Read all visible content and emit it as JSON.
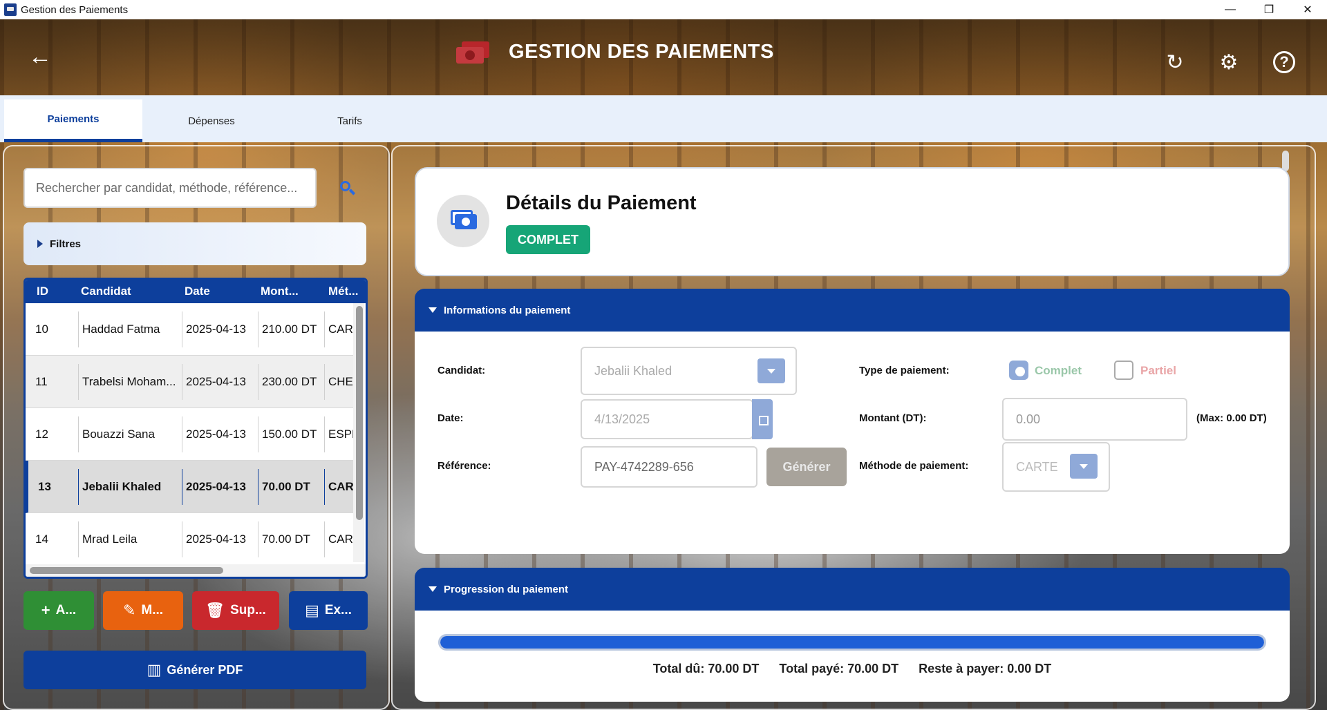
{
  "window": {
    "title": "Gestion des Paiements",
    "minimize": "—",
    "maximize": "❐",
    "close": "✕"
  },
  "header": {
    "title": "GESTION DES PAIEMENTS",
    "back": "←",
    "refresh": "↻",
    "settings": "⚙",
    "help": "?"
  },
  "tabs": [
    {
      "label": "Paiements",
      "active": true
    },
    {
      "label": "Dépenses",
      "active": false
    },
    {
      "label": "Tarifs",
      "active": false
    }
  ],
  "search": {
    "placeholder": "Rechercher par candidat, méthode, référence..."
  },
  "filters": {
    "label": "Filtres"
  },
  "table": {
    "columns": [
      "ID",
      "Candidat",
      "Date",
      "Mont...",
      "Mét..."
    ],
    "rows": [
      {
        "id": "10",
        "candidat": "Haddad Fatma",
        "date": "2025-04-13",
        "montant": "210.00 DT",
        "methode": "CARTE"
      },
      {
        "id": "11",
        "candidat": "Trabelsi Moham...",
        "date": "2025-04-13",
        "montant": "230.00 DT",
        "methode": "CHEQUE"
      },
      {
        "id": "12",
        "candidat": "Bouazzi Sana",
        "date": "2025-04-13",
        "montant": "150.00 DT",
        "methode": "ESPECES"
      },
      {
        "id": "13",
        "candidat": "Jebalii Khaled",
        "date": "2025-04-13",
        "montant": "70.00 DT",
        "methode": "CARTE"
      },
      {
        "id": "14",
        "candidat": "Mrad Leila",
        "date": "2025-04-13",
        "montant": "70.00 DT",
        "methode": "CARTE"
      }
    ]
  },
  "actions": {
    "add": "A...",
    "edit": "M...",
    "delete": "Sup...",
    "export": "Ex...",
    "pdf": "Générer PDF"
  },
  "details": {
    "title": "Détails du Paiement",
    "status": "COMPLET",
    "info_section": "Informations du paiement",
    "candidat_label": "Candidat:",
    "candidat_value": "Jebalii Khaled",
    "date_label": "Date:",
    "date_value": "4/13/2025",
    "reference_label": "Référence:",
    "reference_value": "PAY-4742289-656",
    "generate_label": "Générer",
    "type_label": "Type de paiement:",
    "type_complet": "Complet",
    "type_partiel": "Partiel",
    "montant_label": "Montant (DT):",
    "montant_value": "0.00",
    "max_label": "(Max: 0.00 DT)",
    "methode_label": "Méthode de paiement:",
    "methode_value": "CARTE"
  },
  "progress": {
    "section": "Progression du paiement",
    "fraction": 1.0,
    "total_du": "Total dû: 70.00 DT",
    "total_paye": "Total payé: 70.00 DT",
    "reste": "Reste à payer: 0.00 DT"
  },
  "colors": {
    "primary": "#0d3f9c",
    "success": "#16a577",
    "add": "#2f8f35",
    "edit": "#e8620f",
    "delete": "#c9282d",
    "export": "#0d3f9c"
  }
}
